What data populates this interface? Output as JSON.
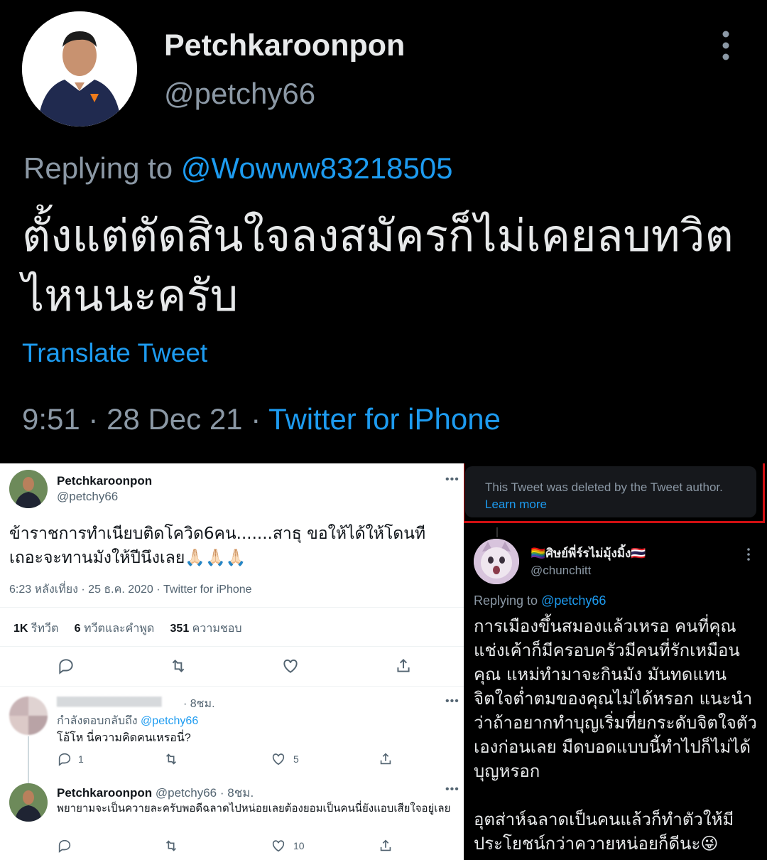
{
  "top_tweet": {
    "display_name": "Petchkaroonpon",
    "handle": "@petchy66",
    "replying_prefix": "Replying to",
    "replying_to": "@Wowww83218505",
    "body": "ตั้งแต่ตัดสินใจลงสมัครก็ไม่เคยลบทวิตไหนนะครับ",
    "translate_label": "Translate Tweet",
    "timestamp": "9:51 · 28 Dec 21 · ",
    "source": "Twitter for iPhone",
    "icons": {
      "avatar": "profile-photo",
      "more": "vertical-dots-icon"
    }
  },
  "left_panel": {
    "tweet": {
      "display_name": "Petchkaroonpon",
      "handle": "@petchy66",
      "more": "•••",
      "body": "ข้าราชการทำเนียบติดโควิด6คน.......สาธุ ขอให้ได้ให้โดนที เถอะจะทานมังให้ปีนึงเลย🙏🏻🙏🏻🙏🏻",
      "meta": "6:23 หลังเที่ยง · 25 ธ.ค. 2020 · Twitter for iPhone",
      "stats": [
        {
          "count": "1K",
          "label": "รีทวีต"
        },
        {
          "count": "6",
          "label": "ทวีตและคำพูด"
        },
        {
          "count": "351",
          "label": "ความชอบ"
        }
      ]
    },
    "reply1": {
      "name_blurred": "▇▇▇▇▇▇▇▇▇▇▇▇▇▇▇",
      "time": "· 8ชม.",
      "more": "•••",
      "replying_prefix": "กำลังตอบกลับถึง",
      "replying_to": "@petchy66",
      "body": "โอ้โห นี่ความคิดคนเหรอนี่?",
      "reply_count": "1",
      "like_count": "5"
    },
    "reply2": {
      "display_name": "Petchkaroonpon",
      "handle": "@petchy66",
      "time": "· 8ชม.",
      "more": "•••",
      "body": "พยายามจะเป็นควายละครับพอดีฉลาดไปหน่อยเลยต้องยอมเป็นคนนี่ยังแอบเสียใจอยู่เลย",
      "like_count": "10"
    }
  },
  "right_panel": {
    "deleted_notice": "This Tweet was deleted by the Tweet author.",
    "learn_more": "Learn more",
    "display_name": "🏳️‍🌈ศิษย์พี่ร์รไม่มุ้งมิ้ง🇹🇭",
    "handle": "@chunchitt",
    "replying_prefix": "Replying to",
    "replying_to": "@petchy66",
    "body": "การเมืองขึ้นสมองแล้วเหรอ คนที่คุณแช่งเค้าก็มีครอบครัวมีคนที่รักเหมือนคุณ แหม่ทำมาจะกินมัง มันทดแทนจิตใจต่ำตมของคุณไม่ได้หรอก แนะนำว่าถ้าอยากทำบุญเริ่มที่ยกระดับจิตใจตัวเองก่อนเลย มืดบอดแบบนี้ทำไปก็ไม่ได้บุญหรอก\n\nอุตส่าห์ฉลาดเป็นคนแล้วก็ทำตัวให้มีประโยชน์กว่าควายหน่อยก็ดีนะ😜",
    "highlight_color": "#d10f12"
  }
}
